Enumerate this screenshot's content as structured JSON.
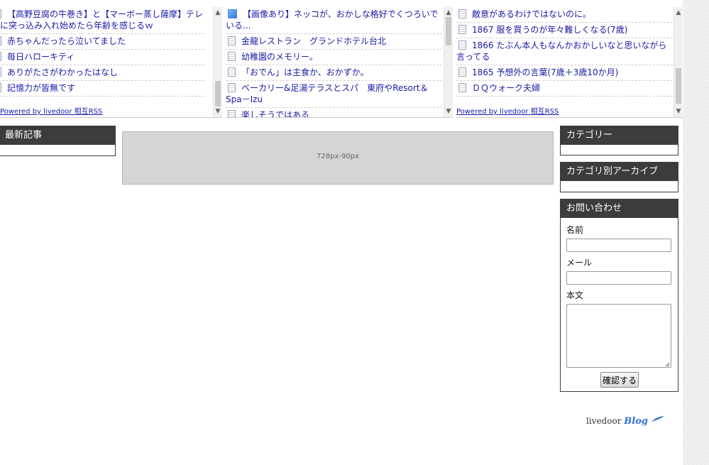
{
  "rss_columns": [
    {
      "items": [
        "【高野豆腐の牛巻き】と【マーボー蒸し薩摩】テレビに突っ込み入れ始めたら年齢を感じるｗ",
        "赤ちゃんだったら泣いてました",
        "毎日ハローキティ",
        "ありがたさがわかったはなし",
        "記憶力が皆無です"
      ],
      "powered": "Powered by livedoor 相互RSS"
    },
    {
      "items": [
        "【画像あり】ネッコが、おかしな格好でくつろいでいる...",
        "金龍レストラン　グランドホテル台北",
        "幼稚園のメモリー。",
        "「おでん」は主食か、おかずか。",
        "ベーカリー&足湯テラスとスパ　東府やResort＆Spa－Izu",
        "楽しそうではある"
      ]
    },
    {
      "items": [
        "敵意があるわけではないのに。",
        "1867 服を買うのが年々難しくなる(7歳)",
        "1866 たぶん本人もなんかおかしいなと思いながら言ってる",
        "1865 予想外の言葉(7歳＋3歳10か月)",
        "ＤＱウォーク夫婦"
      ],
      "powered": "Powered by livedoor 相互RSS"
    }
  ],
  "widgets": {
    "latest": "最新記事",
    "category": "カテゴリー",
    "archive": "カテゴリ別アーカイブ",
    "contact": "お問い合わせ"
  },
  "ad": {
    "label": "728px-90px"
  },
  "form": {
    "name_label": "名前",
    "mail_label": "メール",
    "body_label": "本文",
    "submit": "確認する"
  },
  "logo": {
    "text": "livedoor",
    "blog": "Blog"
  }
}
